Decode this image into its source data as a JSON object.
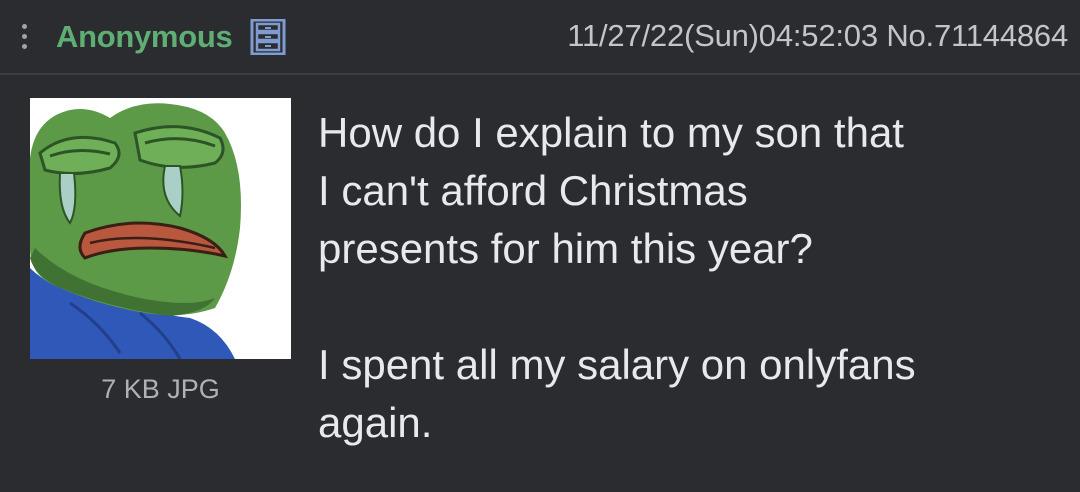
{
  "post": {
    "name": "Anonymous",
    "date": "11/27/22(Sun)04:52:03",
    "number_label": "No.",
    "number": "71144864",
    "file": {
      "size_type": "7 KB JPG",
      "thumbnail_icon": "crying-frog-image"
    },
    "comment": {
      "line1": "How do I explain to my son that",
      "line2": "I can't afford Christmas",
      "line3": "presents for him this year?",
      "line4": "I spent all my salary on onlyfans",
      "line5": "again."
    }
  },
  "icons": {
    "menu": "menu-dots-icon",
    "flag": "filing-cabinet-icon"
  },
  "colors": {
    "background": "#2b2c30",
    "name": "#5fae74",
    "text": "#e8e9ec",
    "meta": "#c3c5cb",
    "flag": "#7f9cd1"
  }
}
